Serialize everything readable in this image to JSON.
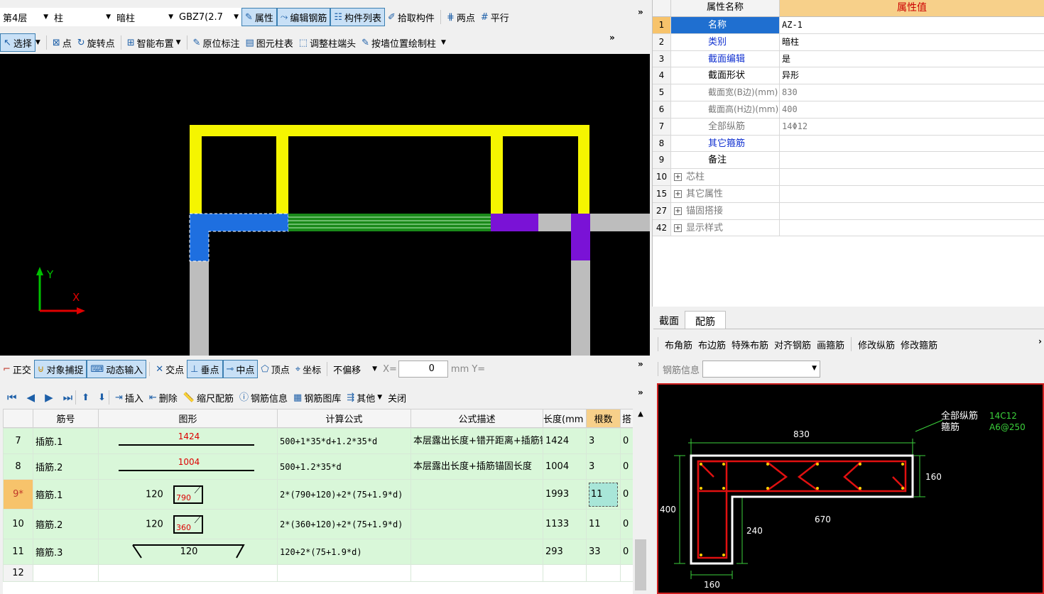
{
  "toolbar1": {
    "floor": "第4层",
    "category": "柱",
    "type": "暗柱",
    "component": "GBZ7(2.7",
    "btn_property": "属性",
    "btn_edit_rebar": "编辑钢筋",
    "btn_component_list": "构件列表",
    "btn_pick": "拾取构件",
    "btn_two_points": "两点",
    "btn_parallel": "平行"
  },
  "toolbar2": {
    "select": "选择",
    "point": "点",
    "rotate_point": "旋转点",
    "smart_layout": "智能布置",
    "origin_mark": "原位标注",
    "element_table": "图元柱表",
    "adjust_end": "调整柱端头",
    "draw_by_wall": "按墙位置绘制柱"
  },
  "canvas_axis": {
    "y": "Y",
    "x": "X"
  },
  "snapbar": {
    "ortho": "正交",
    "object_snap": "对象捕捉",
    "dynamic_input": "动态输入",
    "intersection": "交点",
    "perpendicular": "垂点",
    "midpoint": "中点",
    "vertex": "顶点",
    "coordinate": "坐标",
    "offset_mode": "不偏移",
    "x_label": "X=",
    "x_value": "0",
    "unit_y": "mm Y="
  },
  "rebar_toolbar": {
    "insert": "插入",
    "delete": "删除",
    "scale_rebar": "缩尺配筋",
    "rebar_info": "钢筋信息",
    "rebar_library": "钢筋图库",
    "other": "其他",
    "close": "关闭"
  },
  "rebar_table": {
    "headers": [
      "筋号",
      "图形",
      "计算公式",
      "公式描述",
      "长度(mm",
      "根数",
      "搭"
    ],
    "rows": [
      {
        "num": "7",
        "name": "插筋.1",
        "shape_text": "1424",
        "formula": "500+1*35*d+1.2*35*d",
        "desc": "本层露出长度+错开距离+插筋锚固长度",
        "length": "1424",
        "count": "3",
        "extra": "0"
      },
      {
        "num": "8",
        "name": "插筋.2",
        "shape_text": "1004",
        "formula": "500+1.2*35*d",
        "desc": "本层露出长度+插筋锚固长度",
        "length": "1004",
        "count": "3",
        "extra": "0"
      },
      {
        "num": "9*",
        "name": "箍筋.1",
        "shape_a": "120",
        "shape_text": "790",
        "formula": "2*(790+120)+2*(75+1.9*d)",
        "desc": "",
        "length": "1993",
        "count": "11",
        "extra": "0"
      },
      {
        "num": "10",
        "name": "箍筋.2",
        "shape_a": "120",
        "shape_text": "360",
        "formula": "2*(360+120)+2*(75+1.9*d)",
        "desc": "",
        "length": "1133",
        "count": "11",
        "extra": "0"
      },
      {
        "num": "11",
        "name": "箍筋.3",
        "shape_text": "120",
        "formula": "120+2*(75+1.9*d)",
        "desc": "",
        "length": "293",
        "count": "33",
        "extra": "0"
      },
      {
        "num": "12",
        "name": "",
        "shape_text": "",
        "formula": "",
        "desc": "",
        "length": "",
        "count": "",
        "extra": ""
      }
    ]
  },
  "property_grid": {
    "header_name": "属性名称",
    "header_value": "属性值",
    "rows": [
      {
        "num": "1",
        "key": "名称",
        "value": "AZ-1"
      },
      {
        "num": "2",
        "key": "类别",
        "value": "暗柱"
      },
      {
        "num": "3",
        "key": "截面编辑",
        "value": "是"
      },
      {
        "num": "4",
        "key": "截面形状",
        "value": "异形"
      },
      {
        "num": "5",
        "key": "截面宽(B边)(mm)",
        "value": "830"
      },
      {
        "num": "6",
        "key": "截面高(H边)(mm)",
        "value": "400"
      },
      {
        "num": "7",
        "key": "全部纵筋",
        "value": "14Φ12"
      },
      {
        "num": "8",
        "key": "其它箍筋",
        "value": ""
      },
      {
        "num": "9",
        "key": "备注",
        "value": ""
      },
      {
        "num": "10",
        "key": "芯柱",
        "value": ""
      },
      {
        "num": "15",
        "key": "其它属性",
        "value": ""
      },
      {
        "num": "27",
        "key": "锚固搭接",
        "value": ""
      },
      {
        "num": "42",
        "key": "显示样式",
        "value": ""
      }
    ]
  },
  "section_tabs": {
    "tab1": "截面",
    "tab2": "配筋"
  },
  "section_toolbar": {
    "corner": "布角筋",
    "edge": "布边筋",
    "special": "特殊布筋",
    "align": "对齐钢筋",
    "stirrup": "画箍筋",
    "modify_long": "修改纵筋",
    "modify_stirrup": "修改箍筋",
    "rebar_info_label": "钢筋信息"
  },
  "section_drawing": {
    "label_all_long": "全部纵筋",
    "label_stirrup": "箍筋",
    "value_all_long": "14C12",
    "value_stirrup": "A6@250",
    "dim_top": "830",
    "dim_right": "160",
    "dim_left": "400",
    "dim_670": "670",
    "dim_240": "240",
    "dim_bottom": "160"
  },
  "colors": {
    "accent": "#3c7fb1",
    "selection_row": "#d9f7d9",
    "canvas_bg": "#000000"
  }
}
